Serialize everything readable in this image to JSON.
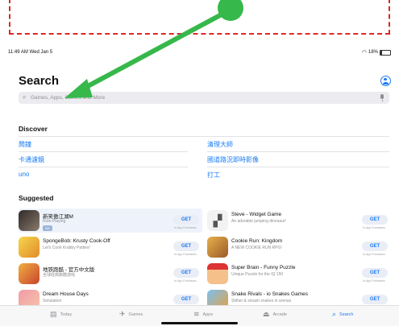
{
  "status": {
    "time": "11:49 AM  Wed Jan 5",
    "battery": "18%"
  },
  "page": {
    "title": "Search"
  },
  "search": {
    "placeholder": "Games, Apps, Stories and More"
  },
  "discover": {
    "heading": "Discover",
    "left": [
      "鬧鐘",
      "卡通濾鏡",
      "uno"
    ],
    "right": [
      "清理大師",
      "國道路況即時影像",
      "打工"
    ]
  },
  "suggested": {
    "heading": "Suggested",
    "get_label": "GET",
    "inapp_label": "In-App Purchases",
    "left": [
      {
        "name": "新笑傲江湖M",
        "sub": "Role-Playing",
        "badge": "AD"
      },
      {
        "name": "SpongeBob: Krusty Cook-Off",
        "sub": "Let's Cook Krabby Patties!"
      },
      {
        "name": "地铁跑酷 - 官方中文版",
        "sub": "全球经典跑酷游戏"
      },
      {
        "name": "Dream House Days",
        "sub": "Simulation"
      }
    ],
    "right": [
      {
        "name": "Steve - Widget Game",
        "sub": "An adorable jumping dinosaur!"
      },
      {
        "name": "Cookie Run: Kingdom",
        "sub": "A NEW COOKIE RUN RPG!"
      },
      {
        "name": "Super Brain - Funny Puzzle",
        "sub": "Unique Puzzle for the IQ 150"
      },
      {
        "name": "Snake Rivals - io Snakes Games",
        "sub": "Slither & smash snakes in arenas"
      }
    ]
  },
  "tabs": [
    {
      "label": "Today",
      "icon": "today-icon"
    },
    {
      "label": "Games",
      "icon": "games-icon"
    },
    {
      "label": "Apps",
      "icon": "apps-icon"
    },
    {
      "label": "Arcade",
      "icon": "arcade-icon"
    },
    {
      "label": "Search",
      "icon": "search-icon"
    }
  ],
  "colors": {
    "accent": "#1a7cf5",
    "annotation_arrow": "#36b84a",
    "annotation_box": "#d62a2a"
  }
}
